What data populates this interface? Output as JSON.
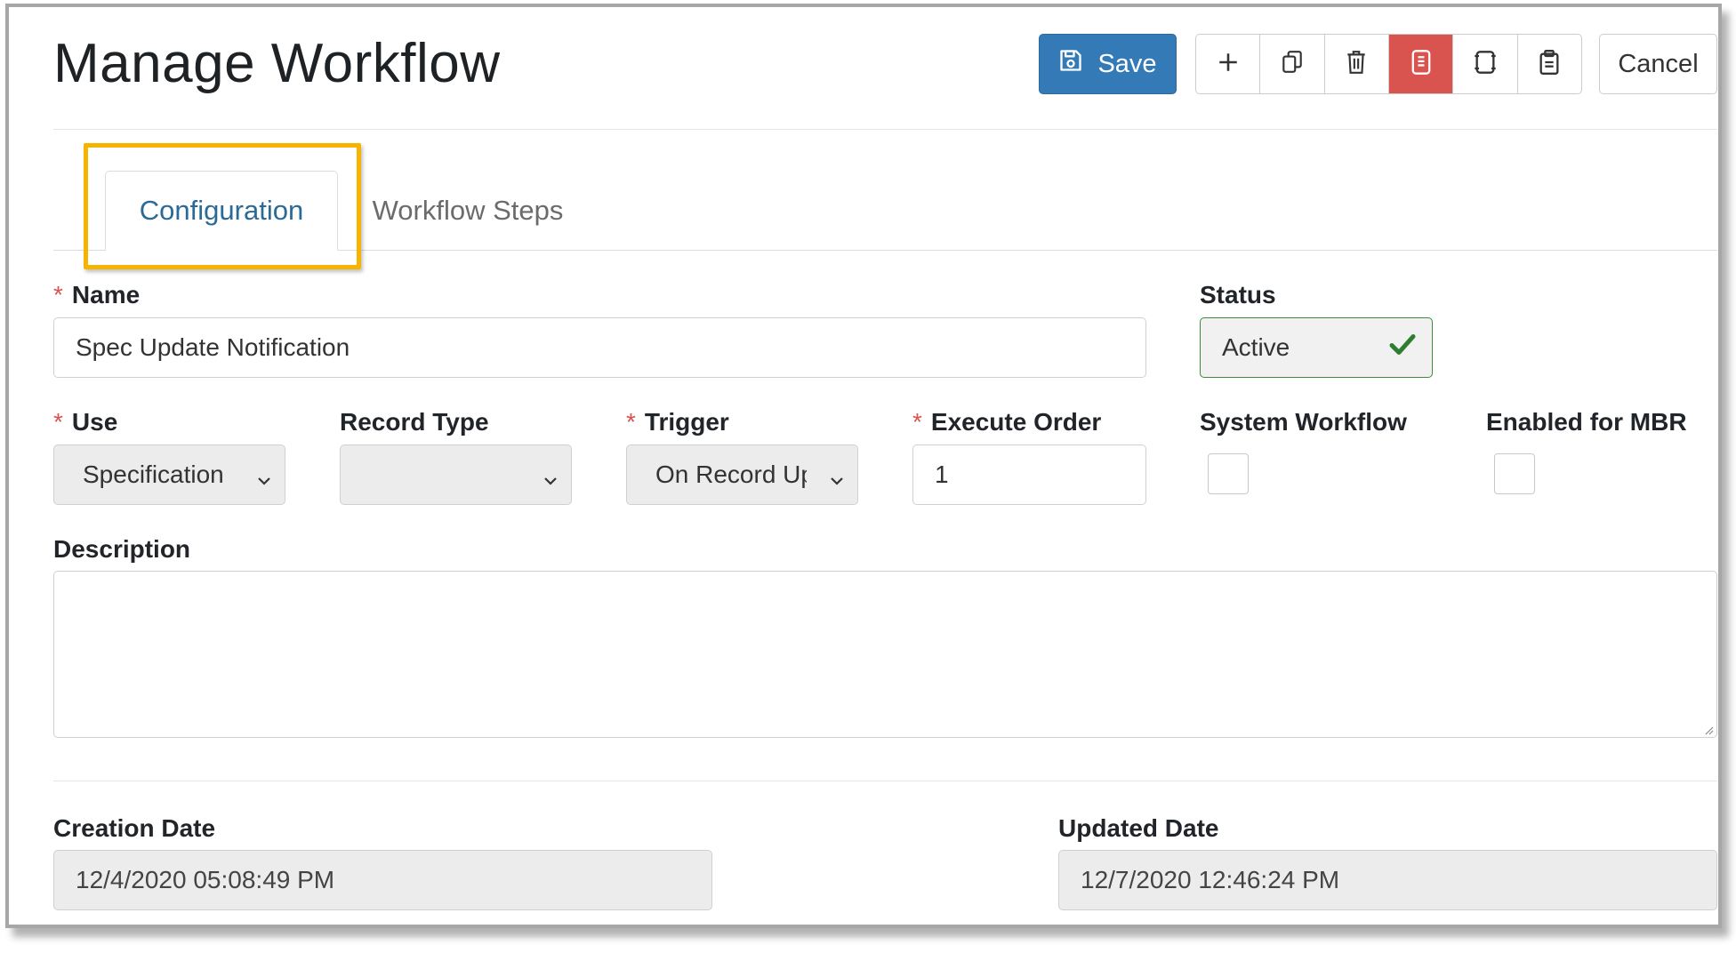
{
  "header": {
    "title": "Manage Workflow",
    "save_label": "Save",
    "cancel_label": "Cancel",
    "toolbar_icons": [
      "plus-icon",
      "copy-icon",
      "trash-icon",
      "document-icon",
      "layout-icon",
      "clipboard-icon"
    ]
  },
  "tabs": [
    {
      "label": "Configuration",
      "active": true
    },
    {
      "label": "Workflow Steps",
      "active": false
    }
  ],
  "form": {
    "required_mark": "*",
    "name_label": "Name",
    "name_value": "Spec Update Notification",
    "status_label": "Status",
    "status_value": "Active",
    "use_label": "Use",
    "use_value": "Specification",
    "record_type_label": "Record Type",
    "record_type_value": "",
    "trigger_label": "Trigger",
    "trigger_value": "On Record Up",
    "execute_order_label": "Execute Order",
    "execute_order_value": "1",
    "system_workflow_label": "System Workflow",
    "system_workflow_checked": false,
    "enabled_mbr_label": "Enabled for MBR",
    "enabled_mbr_checked": false,
    "description_label": "Description",
    "description_value": "",
    "creation_date_label": "Creation Date",
    "creation_date_value": "12/4/2020 05:08:49 PM",
    "updated_date_label": "Updated Date",
    "updated_date_value": "12/7/2020 12:46:24 PM"
  },
  "colors": {
    "primary": "#337ab7",
    "danger": "#d9534f",
    "highlight": "#f5b400",
    "success": "#2e7d32",
    "tab_active_text": "#2a6a96"
  }
}
